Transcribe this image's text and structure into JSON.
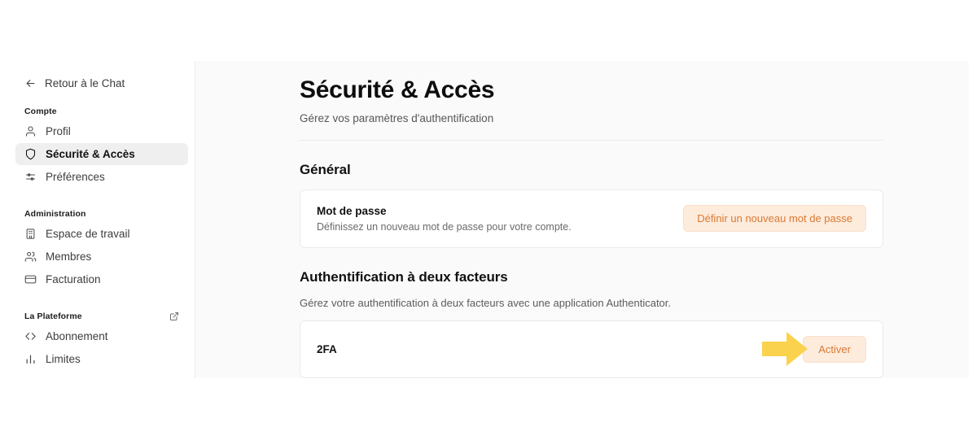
{
  "sidebar": {
    "back": {
      "label": "Retour à le Chat",
      "icon": "arrow-left-icon"
    },
    "groups": [
      {
        "label": "Compte",
        "external_link": false,
        "items": [
          {
            "label": "Profil",
            "icon": "user-icon",
            "active": false
          },
          {
            "label": "Sécurité & Accès",
            "icon": "shield-icon",
            "active": true
          },
          {
            "label": "Préférences",
            "icon": "sliders-icon",
            "active": false
          }
        ]
      },
      {
        "label": "Administration",
        "external_link": false,
        "items": [
          {
            "label": "Espace de travail",
            "icon": "building-icon",
            "active": false
          },
          {
            "label": "Membres",
            "icon": "users-icon",
            "active": false
          },
          {
            "label": "Facturation",
            "icon": "credit-card-icon",
            "active": false
          }
        ]
      },
      {
        "label": "La Plateforme",
        "external_link": true,
        "items": [
          {
            "label": "Abonnement",
            "icon": "code-brackets-icon",
            "active": false
          },
          {
            "label": "Limites",
            "icon": "bar-chart-icon",
            "active": false
          }
        ]
      }
    ]
  },
  "page": {
    "title": "Sécurité & Accès",
    "subtitle": "Gérez vos paramètres d'authentification"
  },
  "sections": {
    "general": {
      "title": "Général",
      "card": {
        "title": "Mot de passe",
        "description": "Définissez un nouveau mot de passe pour votre compte.",
        "button": "Définir un nouveau mot de passe"
      }
    },
    "two_factor": {
      "title": "Authentification à deux facteurs",
      "description": "Gérez votre authentification à deux facteurs avec une application Authenticator.",
      "card": {
        "title": "2FA",
        "button": "Activer"
      }
    }
  },
  "annotation": {
    "arrow": "arrow-right-annotation",
    "color": "#fbd24e",
    "points_at": "Activer"
  },
  "colors": {
    "accent_button_bg": "#fdebdc",
    "accent_button_text": "#d97a34",
    "sidebar_active_bg": "#efefef",
    "content_bg": "#fafafa"
  }
}
